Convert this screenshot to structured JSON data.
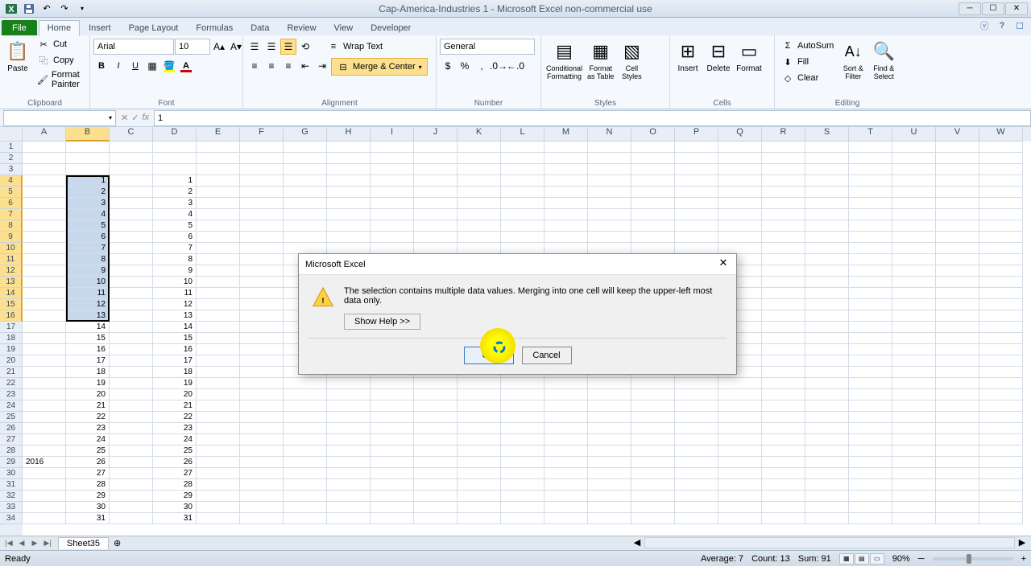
{
  "window": {
    "title": "Cap-America-Industries 1 - Microsoft Excel non-commercial use"
  },
  "tabs": {
    "file": "File",
    "items": [
      "Home",
      "Insert",
      "Page Layout",
      "Formulas",
      "Data",
      "Review",
      "View",
      "Developer"
    ],
    "active": "Home"
  },
  "ribbon": {
    "clipboard": {
      "label": "Clipboard",
      "paste": "Paste",
      "cut": "Cut",
      "copy": "Copy",
      "format_painter": "Format Painter"
    },
    "font": {
      "label": "Font",
      "name": "Arial",
      "size": "10"
    },
    "alignment": {
      "label": "Alignment",
      "wrap": "Wrap Text",
      "merge": "Merge & Center"
    },
    "number": {
      "label": "Number",
      "format": "General"
    },
    "styles": {
      "label": "Styles",
      "conditional": "Conditional\nFormatting",
      "table": "Format\nas Table",
      "cell": "Cell\nStyles"
    },
    "cells": {
      "label": "Cells",
      "insert": "Insert",
      "delete": "Delete",
      "format": "Format"
    },
    "editing": {
      "label": "Editing",
      "autosum": "AutoSum",
      "fill": "Fill",
      "clear": "Clear",
      "sort": "Sort &\nFilter",
      "find": "Find &\nSelect"
    }
  },
  "formula_bar": {
    "name_box": "",
    "fx": "fx",
    "value": "1"
  },
  "columns": [
    "A",
    "B",
    "C",
    "D",
    "E",
    "F",
    "G",
    "H",
    "I",
    "J",
    "K",
    "L",
    "M",
    "N",
    "O",
    "P",
    "Q",
    "R",
    "S",
    "T",
    "U",
    "V",
    "W"
  ],
  "data": {
    "col_b": [
      "1",
      "2",
      "3",
      "4",
      "5",
      "6",
      "7",
      "8",
      "9",
      "10",
      "11",
      "12",
      "13",
      "14",
      "15",
      "16",
      "17",
      "18",
      "19",
      "20",
      "21",
      "22",
      "23",
      "24",
      "25",
      "26",
      "27",
      "28",
      "29",
      "30",
      "31"
    ],
    "col_d": [
      "1",
      "2",
      "3",
      "4",
      "5",
      "6",
      "7",
      "8",
      "9",
      "10",
      "11",
      "12",
      "13",
      "14",
      "15",
      "16",
      "17",
      "18",
      "19",
      "20",
      "21",
      "22",
      "23",
      "24",
      "25",
      "26",
      "27",
      "28",
      "29",
      "30",
      "31"
    ],
    "a29": "2016"
  },
  "selection": {
    "range": "B4:B16"
  },
  "sheet_tab": "Sheet35",
  "status": {
    "ready": "Ready",
    "average": "Average: 7",
    "count": "Count: 13",
    "sum": "Sum: 91",
    "zoom": "90%"
  },
  "dialog": {
    "title": "Microsoft Excel",
    "message": "The selection contains multiple data values.  Merging into one cell will keep the upper-left most data only.",
    "show_help": "Show Help >>",
    "ok": "OK",
    "cancel": "Cancel"
  }
}
